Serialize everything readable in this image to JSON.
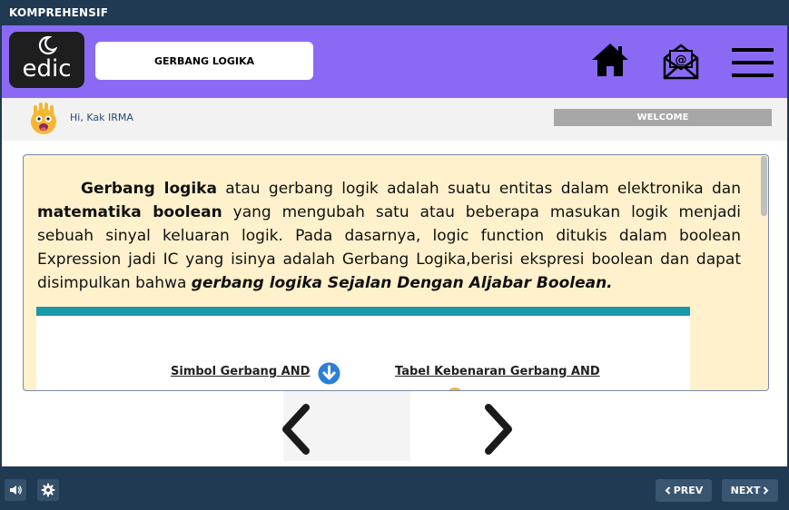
{
  "window": {
    "title": "KOMPREHENSIF"
  },
  "header": {
    "logo_text": "edic",
    "page_pill": "GERBANG LOGIKA",
    "icons": [
      "home-icon",
      "email-icon",
      "menu-icon"
    ]
  },
  "user": {
    "greeting": "Hi, Kak IRMA"
  },
  "welcome_label": "WELCOME",
  "content": {
    "p_term1": "Gerbang logika",
    "p_text1": " atau gerbang logik adalah suatu entitas dalam elektronika dan ",
    "p_term2": "matematika boolean",
    "p_text2": " yang mengubah satu atau beberapa masukan logik menjadi sebuah sinyal keluaran logik. Pada dasarnya, logic function ditukis dalam boolean Expression jadi IC yang isinya adalah Gerbang Logika,berisi ekspresi boolean dan dapat disimpulkan bahwa ",
    "p_emph": "gerbang logika Sejalan Dengan Aljabar Boolean.",
    "image_caption_left": "Simbol  Gerbang AND",
    "image_caption_right": "Tabel Kebenaran Gerbang AND"
  },
  "footer": {
    "prev_label": "PREV",
    "next_label": "NEXT",
    "icons": [
      "speaker-icon",
      "gear-icon"
    ]
  },
  "colors": {
    "header_bg": "#8a6af5",
    "bar_bg": "#1f3a52",
    "content_bg": "#fff1cc",
    "teal": "#1a98a8",
    "welcome_bg": "#a7a7a7"
  }
}
